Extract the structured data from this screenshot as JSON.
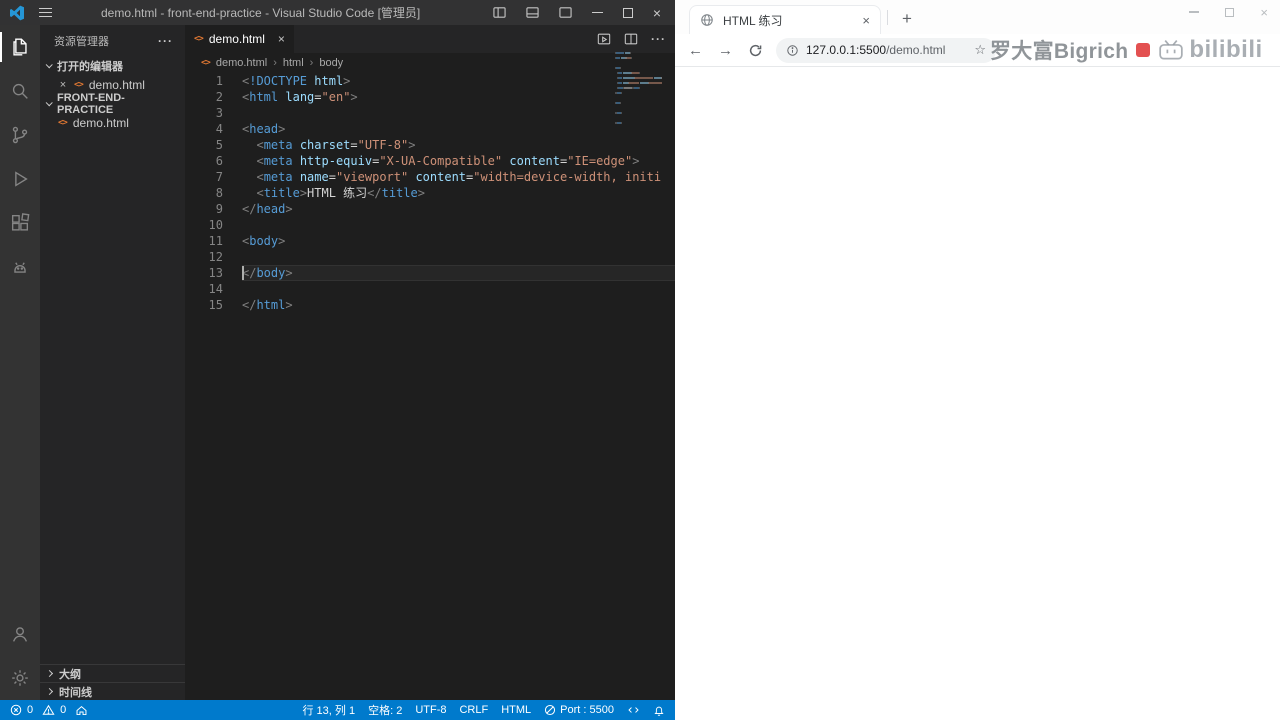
{
  "icons": {
    "close": "×",
    "add": "+",
    "back": "←",
    "forward": "→",
    "star": "☆",
    "more_h": "···",
    "sep": "›",
    "html_badge": "<>"
  },
  "vscode": {
    "title": "demo.html - front-end-practice - Visual Studio Code [管理员]",
    "explorer": {
      "header": "资源管理器",
      "open_editors_label": "打开的编辑器",
      "open_file": "demo.html",
      "folder_label": "FRONT-END-PRACTICE",
      "folder_file": "demo.html",
      "outline_label": "大纲",
      "timeline_label": "时间线"
    },
    "editor": {
      "tab_label": "demo.html",
      "breadcrumb": {
        "file": "demo.html",
        "node1": "html",
        "node2": "body"
      },
      "active_line": 13,
      "code_lines": [
        [
          [
            "p",
            "<"
          ],
          [
            "t",
            "!DOCTYPE"
          ],
          [
            "d",
            " "
          ],
          [
            "a",
            "html"
          ],
          [
            "p",
            ">"
          ]
        ],
        [
          [
            "p",
            "<"
          ],
          [
            "t",
            "html"
          ],
          [
            "d",
            " "
          ],
          [
            "a",
            "lang"
          ],
          [
            "o",
            "="
          ],
          [
            "s",
            "\"en\""
          ],
          [
            "p",
            ">"
          ]
        ],
        [],
        [
          [
            "p",
            "<"
          ],
          [
            "t",
            "head"
          ],
          [
            "p",
            ">"
          ]
        ],
        [
          [
            "d",
            "  "
          ],
          [
            "p",
            "<"
          ],
          [
            "t",
            "meta"
          ],
          [
            "d",
            " "
          ],
          [
            "a",
            "charset"
          ],
          [
            "o",
            "="
          ],
          [
            "s",
            "\"UTF-8\""
          ],
          [
            "p",
            ">"
          ]
        ],
        [
          [
            "d",
            "  "
          ],
          [
            "p",
            "<"
          ],
          [
            "t",
            "meta"
          ],
          [
            "d",
            " "
          ],
          [
            "a",
            "http-equiv"
          ],
          [
            "o",
            "="
          ],
          [
            "s",
            "\"X-UA-Compatible\""
          ],
          [
            "d",
            " "
          ],
          [
            "a",
            "content"
          ],
          [
            "o",
            "="
          ],
          [
            "s",
            "\"IE=edge\""
          ],
          [
            "p",
            ">"
          ]
        ],
        [
          [
            "d",
            "  "
          ],
          [
            "p",
            "<"
          ],
          [
            "t",
            "meta"
          ],
          [
            "d",
            " "
          ],
          [
            "a",
            "name"
          ],
          [
            "o",
            "="
          ],
          [
            "s",
            "\"viewport\""
          ],
          [
            "d",
            " "
          ],
          [
            "a",
            "content"
          ],
          [
            "o",
            "="
          ],
          [
            "s",
            "\"width=device-width, initi"
          ]
        ],
        [
          [
            "d",
            "  "
          ],
          [
            "p",
            "<"
          ],
          [
            "t",
            "title"
          ],
          [
            "p",
            ">"
          ],
          [
            "x",
            "HTML 练习"
          ],
          [
            "p",
            "</"
          ],
          [
            "t",
            "title"
          ],
          [
            "p",
            ">"
          ]
        ],
        [
          [
            "p",
            "</"
          ],
          [
            "t",
            "head"
          ],
          [
            "p",
            ">"
          ]
        ],
        [],
        [
          [
            "p",
            "<"
          ],
          [
            "t",
            "body"
          ],
          [
            "p",
            ">"
          ]
        ],
        [],
        [
          [
            "p",
            "</"
          ],
          [
            "t",
            "body"
          ],
          [
            "p",
            ">"
          ]
        ],
        [],
        [
          [
            "p",
            "</"
          ],
          [
            "t",
            "html"
          ],
          [
            "p",
            ">"
          ]
        ]
      ]
    },
    "status": {
      "errors": "0",
      "warnings": "0",
      "items": [
        "行 13, 列 1",
        "空格: 2",
        "UTF-8",
        "CRLF",
        "HTML",
        "Port : 5500"
      ]
    }
  },
  "browser": {
    "tab_title": "HTML 练习",
    "url_host": "127.0.0.1:5500",
    "url_path": "/demo.html"
  },
  "watermark": {
    "author": "罗大富Bigrich",
    "platform": "bilibili"
  }
}
